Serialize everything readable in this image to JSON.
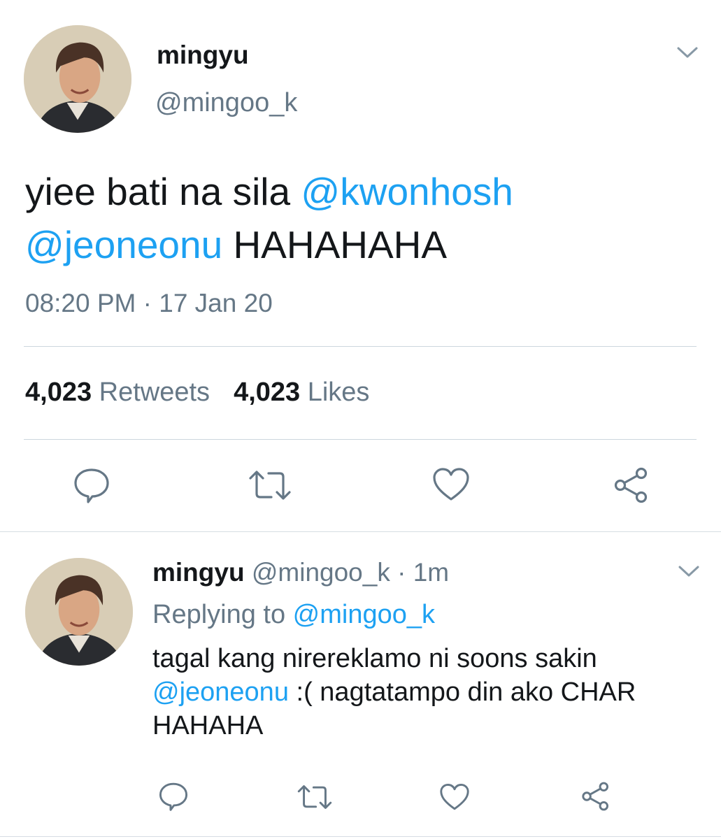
{
  "tweet": {
    "author_name": "mingyu",
    "author_handle": "@mingoo_k",
    "text_part1": "yiee bati na sila ",
    "mention1": "@kwonhosh",
    "mention2": "@jeoneonu",
    "text_part2": " HAHAHAHA",
    "timestamp": "08:20 PM · 17 Jan 20",
    "retweets_count": "4,023",
    "retweets_label": "Retweets",
    "likes_count": "4,023",
    "likes_label": "Likes"
  },
  "reply": {
    "author_name": "mingyu",
    "author_handle": "@mingoo_k",
    "separator": "·",
    "time_ago": "1m",
    "replying_label": "Replying to ",
    "replying_to": "@mingoo_k",
    "text_line1": "tagal kang nirereklamo ni soons sakin",
    "mention": "@jeoneonu",
    "text_line2": " :( nagtatampo din ako CHAR HAHAHA"
  },
  "icons": {
    "menu": "chevron-down-icon",
    "reply": "speech-bubble-icon",
    "retweet": "retweet-arrows-icon",
    "like": "heart-icon",
    "share": "share-nodes-icon"
  },
  "colors": {
    "link": "#1da1f2",
    "muted_text": "#657786",
    "primary_text": "#14171a",
    "divider": "#ccd6dd"
  }
}
